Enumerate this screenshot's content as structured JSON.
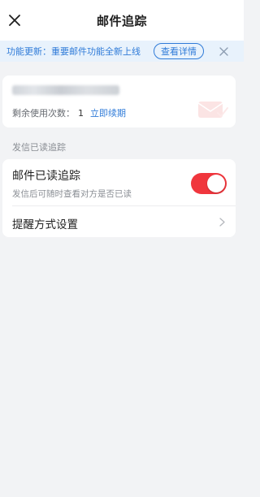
{
  "header": {
    "title": "邮件追踪"
  },
  "banner": {
    "text": "功能更新：重要邮件功能全新上线",
    "button_label": "查看详情"
  },
  "usage": {
    "remaining_label": "剩余使用次数：",
    "remaining_count": "1",
    "renew_link": "立即续期"
  },
  "section": {
    "label": "发信已读追踪"
  },
  "settings": {
    "read_tracking": {
      "title": "邮件已读追踪",
      "subtitle": "发信后可随时查看对方是否已读",
      "enabled": true
    },
    "reminder": {
      "label": "提醒方式设置"
    }
  },
  "colors": {
    "accent": "#2f7bd8",
    "toggle_on": "#f0363d",
    "banner_bg": "#e8f2fc",
    "page_bg": "#f2f3f5"
  },
  "icons": {
    "close": "close-icon",
    "banner_close": "close-icon",
    "chevron": "chevron-right-icon"
  }
}
